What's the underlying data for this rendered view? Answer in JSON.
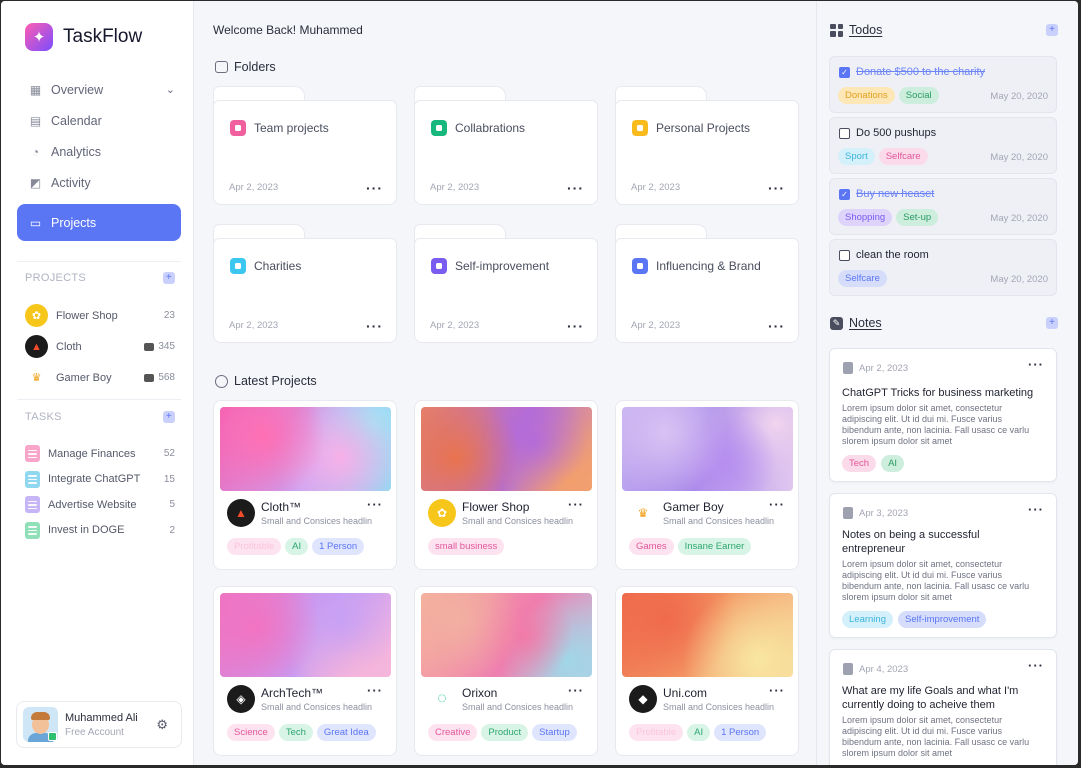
{
  "app": {
    "name": "TaskFlow"
  },
  "nav": [
    {
      "label": "Overview",
      "icon": "grid-icon",
      "active": false,
      "chevron": true
    },
    {
      "label": "Calendar",
      "icon": "calendar-icon",
      "active": false
    },
    {
      "label": "Analytics",
      "icon": "pie-chart-icon",
      "active": false
    },
    {
      "label": "Activity",
      "icon": "activity-icon",
      "active": false
    },
    {
      "label": "Projects",
      "icon": "folder-icon",
      "active": true
    }
  ],
  "projects_section": {
    "title": "PROJECTS",
    "items": [
      {
        "name": "Flower Shop",
        "count": "23"
      },
      {
        "name": "Cloth",
        "count": "345"
      },
      {
        "name": "Gamer Boy",
        "count": "568"
      }
    ]
  },
  "tasks_section": {
    "title": "TASKS",
    "items": [
      {
        "name": "Manage Finances",
        "count": "52",
        "color": "#f7a6c9"
      },
      {
        "name": "Integrate ChatGPT",
        "count": "15",
        "color": "#8fd8f0"
      },
      {
        "name": "Advertise Website",
        "count": "5",
        "color": "#c6b5f7"
      },
      {
        "name": "Invest in DOGE",
        "count": "2",
        "color": "#8fe0b8"
      }
    ]
  },
  "user": {
    "name": "Muhammed Ali",
    "plan": "Free Account"
  },
  "main": {
    "welcome": "Welcome Back! Muhammed",
    "folders_title": "Folders",
    "latest_title": "Latest Projects"
  },
  "folders": [
    {
      "name": "Team projects",
      "date": "Apr 2, 2023",
      "color": "#f0609e"
    },
    {
      "name": "Collabrations",
      "date": "Apr 2, 2023",
      "color": "#18b77e"
    },
    {
      "name": "Personal Projects",
      "date": "Apr 2, 2023",
      "color": "#f7bb1e"
    },
    {
      "name": "Charities",
      "date": "Apr 2, 2023",
      "color": "#3cc7f0"
    },
    {
      "name": "Self-improvement",
      "date": "Apr 2, 2023",
      "color": "#7a5cf0"
    },
    {
      "name": "Influencing & Brand",
      "date": "Apr 2, 2023",
      "color": "#5b76f4"
    }
  ],
  "latest_projects": [
    {
      "name": "Cloth™",
      "subtitle": "Small and Consices headlin",
      "tags": [
        "Profitable",
        "AI",
        "1 Person"
      ]
    },
    {
      "name": "Flower Shop",
      "subtitle": "Small and Consices headlin",
      "tags": [
        "small business"
      ]
    },
    {
      "name": "Gamer Boy",
      "subtitle": "Small and Consices headlin",
      "tags": [
        "Games",
        "Insane Earner"
      ]
    },
    {
      "name": "ArchTech™",
      "subtitle": "Small and Consices headlin",
      "tags": [
        "Science",
        "Tech",
        "Great Idea"
      ]
    },
    {
      "name": "Orixon",
      "subtitle": "Small and Consices headlin",
      "tags": [
        "Creative",
        "Product",
        "Startup"
      ]
    },
    {
      "name": "Uni.com",
      "subtitle": "Small and Consices headlin",
      "tags": [
        "Profitable",
        "AI",
        "1 Person"
      ]
    }
  ],
  "todos_title": "Todos",
  "todos": [
    {
      "text": "Donate $500 to the charity",
      "done": true,
      "tags": [
        "Donations",
        "Social"
      ],
      "date": "May 20, 2020"
    },
    {
      "text": "Do 500 pushups",
      "done": false,
      "tags": [
        "Sport",
        "Selfcare"
      ],
      "date": "May 20, 2020"
    },
    {
      "text": "Buy new heaset",
      "done": true,
      "tags": [
        "Shopping",
        "Set-up"
      ],
      "date": "May 20, 2020"
    },
    {
      "text": "clean the room",
      "done": false,
      "tags": [
        "Selfcare"
      ],
      "date": "May 20, 2020"
    }
  ],
  "notes_title": "Notes",
  "notes": [
    {
      "date": "Apr 2, 2023",
      "title": "ChatGPT Tricks for business marketing",
      "body": "Lorem ipsum dolor sit amet, consectetur adipiscing elit. Ut id dui mi. Fusce varius bibendum ante, non lacinia. Fall usasc ce varlu slorem ipsum dolor sit amet",
      "tags": [
        "Tech",
        "AI"
      ]
    },
    {
      "date": "Apr 3, 2023",
      "title": "Notes on being a successful entrepreneur",
      "body": "Lorem ipsum dolor sit amet, consectetur adipiscing elit. Ut id dui mi. Fusce varius bibendum ante, non lacinia. Fall usasc ce varlu slorem ipsum dolor sit amet",
      "tags": [
        "Learning",
        "Self-improvement"
      ]
    },
    {
      "date": "Apr 4, 2023",
      "title": "What are my life Goals and what I'm currently doing to acheive them",
      "body": "Lorem ipsum dolor sit amet, consectetur adipiscing elit. Ut id dui mi. Fusce varius bibendum ante, non lacinia. Fall usasc ce varlu slorem ipsum dolor sit amet",
      "tags": []
    }
  ]
}
